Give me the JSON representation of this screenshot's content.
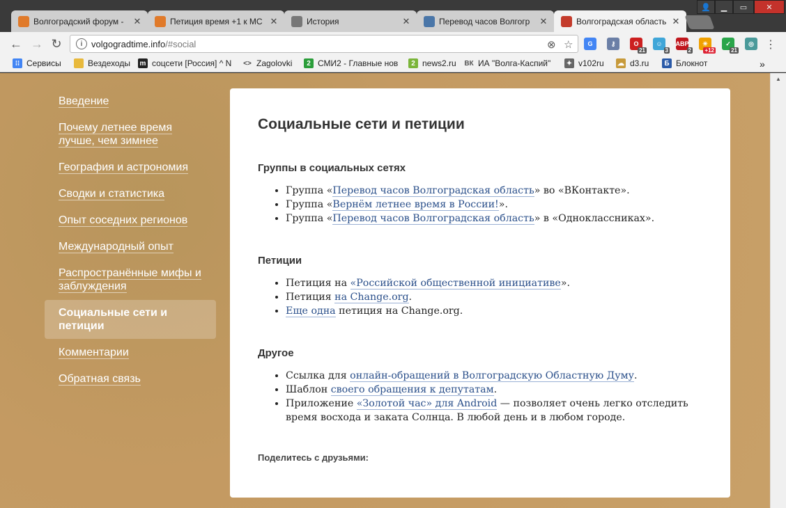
{
  "window": {
    "tabs": [
      {
        "title": "Волгоградский форум -",
        "favicon": "speech-bubble-icon",
        "color": "#e07a2a",
        "active": false
      },
      {
        "title": "Петиция время +1 к МС",
        "favicon": "speech-bubble-icon",
        "color": "#e07a2a",
        "active": false
      },
      {
        "title": "История",
        "favicon": "history-clock-icon",
        "color": "#777777",
        "active": false
      },
      {
        "title": "Перевод часов Волгогр",
        "favicon": "vk-icon",
        "color": "#4a76a8",
        "active": false
      },
      {
        "title": "Волгоградская область -",
        "favicon": "coat-of-arms-icon",
        "color": "#c43b2b",
        "active": true
      }
    ],
    "close_glyph": "✕"
  },
  "address": {
    "host": "volgogradtime.info",
    "path": "/#social"
  },
  "extensions": [
    {
      "name": "translate-icon",
      "color": "#4285f4",
      "label": "G",
      "badge": ""
    },
    {
      "name": "key-icon",
      "color": "#6b7fa6",
      "label": "⚷",
      "badge": ""
    },
    {
      "name": "opera-icon",
      "color": "#cc1f1f",
      "label": "O",
      "badge": "21"
    },
    {
      "name": "ghost-icon",
      "color": "#3fa6d8",
      "label": "☺",
      "badge": "3"
    },
    {
      "name": "adblock-icon",
      "color": "#c0171e",
      "label": "ABP",
      "badge": "2"
    },
    {
      "name": "weather-icon",
      "color": "#f0a000",
      "label": "☀",
      "badge": "+12"
    },
    {
      "name": "shield-check-icon",
      "color": "#2aa54a",
      "label": "✓",
      "badge": "21"
    },
    {
      "name": "circle-arrow-icon",
      "color": "#4a9a9a",
      "label": "◎",
      "badge": ""
    }
  ],
  "bookmarks": [
    {
      "label": "Сервисы",
      "icon": "apps-grid-icon",
      "color": "#4285f4"
    },
    {
      "label": "Вездеходы",
      "icon": "folder-icon",
      "color": "#e8b93c"
    },
    {
      "label": "соцсети [Россия] ^ N",
      "icon": "m-logo-icon",
      "color": "#222222"
    },
    {
      "label": "Zagolovki",
      "icon": "code-brackets-icon",
      "color": "#444444"
    },
    {
      "label": "СМИ2 - Главные нов",
      "icon": "smi2-icon",
      "color": "#2b9e3a"
    },
    {
      "label": "news2.ru",
      "icon": "news2-icon",
      "color": "#7bb53a"
    },
    {
      "label": "ИА \"Волга-Каспий\"",
      "icon": "vk-text-icon",
      "color": "#555555"
    },
    {
      "label": "v102ru",
      "icon": "v102-icon",
      "color": "#666666"
    },
    {
      "label": "d3.ru",
      "icon": "d3-icon",
      "color": "#c79a3b"
    },
    {
      "label": "Блокнот",
      "icon": "b-letter-icon",
      "color": "#2a5aa8"
    }
  ],
  "sidebar": {
    "items": [
      {
        "label": "Введение",
        "active": false
      },
      {
        "label": "Почему летнее время лучше, чем зимнее",
        "active": false
      },
      {
        "label": "География и астрономия",
        "active": false
      },
      {
        "label": "Сводки и статистика",
        "active": false
      },
      {
        "label": "Опыт соседних регионов",
        "active": false
      },
      {
        "label": "Международный опыт",
        "active": false
      },
      {
        "label": "Распространённые мифы и заблуждения",
        "active": false
      },
      {
        "label": "Социальные сети и петиции",
        "active": true
      },
      {
        "label": "Комментарии",
        "active": false
      },
      {
        "label": "Обратная связь",
        "active": false
      }
    ]
  },
  "content": {
    "title": "Социальные сети и петиции",
    "sections": [
      {
        "heading": "Группы в социальных сетях",
        "items": [
          [
            {
              "t": "Группа «"
            },
            {
              "t": "Перевод часов Волгоградская область",
              "link": true
            },
            {
              "t": "» во «ВКонтакте»."
            }
          ],
          [
            {
              "t": "Группа «"
            },
            {
              "t": "Вернём летнее время в России!",
              "link": true
            },
            {
              "t": "»."
            }
          ],
          [
            {
              "t": "Группа «"
            },
            {
              "t": "Перевод часов Волгоградская область",
              "link": true
            },
            {
              "t": "» в «Одноклассниках»."
            }
          ]
        ]
      },
      {
        "heading": "Петиции",
        "items": [
          [
            {
              "t": "Петиция на "
            },
            {
              "t": "«Российской общественной инициативе",
              "link": true
            },
            {
              "t": "»."
            }
          ],
          [
            {
              "t": "Петиция "
            },
            {
              "t": "на Change.org",
              "link": true
            },
            {
              "t": "."
            }
          ],
          [
            {
              "t": "Еще одна",
              "link": true
            },
            {
              "t": " петиция на Change.org."
            }
          ]
        ]
      },
      {
        "heading": "Другое",
        "items": [
          [
            {
              "t": "Ссылка для "
            },
            {
              "t": "онлайн-обращений в Волгоградскую Областную Думу",
              "link": true
            },
            {
              "t": "."
            }
          ],
          [
            {
              "t": "Шаблон "
            },
            {
              "t": "своего обращения к депутатам",
              "link": true
            },
            {
              "t": "."
            }
          ],
          [
            {
              "t": "Приложение "
            },
            {
              "t": "«Золотой час» для Android",
              "link": true
            },
            {
              "t": " — позволяет очень легко отследить время восхода и заката Солнца. В любой день и в любом городе."
            }
          ]
        ]
      }
    ],
    "share_label": "Поделитесь с друзьями:"
  }
}
